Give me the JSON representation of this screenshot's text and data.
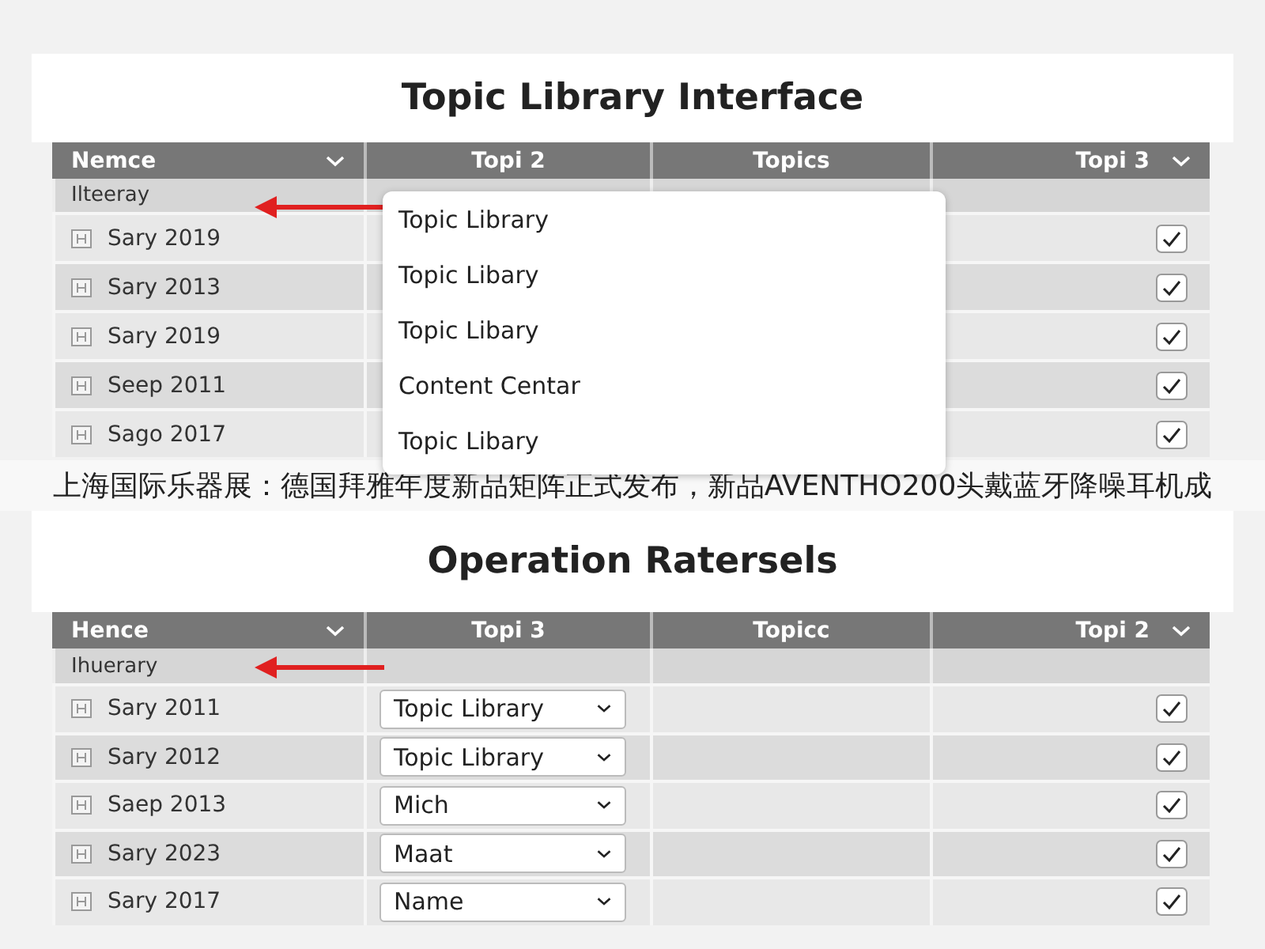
{
  "panels": [
    {
      "title": "Topic Library Interface",
      "columns": [
        {
          "label": "Nemce",
          "has_menu": true
        },
        {
          "label": "Topi 2",
          "has_menu": false
        },
        {
          "label": "Topics",
          "has_menu": false
        },
        {
          "label": "Topi 3",
          "has_menu": true
        }
      ],
      "group_label": "Ilteeray",
      "rows": [
        {
          "name": "Sary 2019",
          "checked": true
        },
        {
          "name": "Sary 2013",
          "checked": true
        },
        {
          "name": "Sary 2019",
          "checked": true
        },
        {
          "name": "Seep 2011",
          "checked": true
        },
        {
          "name": "Sago 2017",
          "checked": true
        }
      ],
      "menu": {
        "items": [
          "Topic Library",
          "Topic Libary",
          "Topic Libary",
          "Content Centar",
          "Topic Libary"
        ]
      }
    },
    {
      "title": "Operation Ratersels",
      "columns": [
        {
          "label": "Hence",
          "has_menu": true
        },
        {
          "label": "Topi 3",
          "has_menu": false
        },
        {
          "label": "Topicc",
          "has_menu": false
        },
        {
          "label": "Topi 2",
          "has_menu": true
        }
      ],
      "group_label": "Ihuerary",
      "rows": [
        {
          "name": "Sary 2011",
          "checked": true,
          "value": "Topic Library"
        },
        {
          "name": "Sary 2012",
          "checked": true,
          "value": "Topic Library"
        },
        {
          "name": "Saep 2013",
          "checked": true,
          "value": "Mich"
        },
        {
          "name": "Sary 2023",
          "checked": true,
          "value": "Maat"
        },
        {
          "name": "Sary 2017",
          "checked": true,
          "value": "Name"
        }
      ]
    }
  ],
  "banner": {
    "text": "上海国际乐器展：德国拜雅年度新品矩阵正式发布，新品AVENTHO200头戴蓝牙降噪耳机成"
  }
}
